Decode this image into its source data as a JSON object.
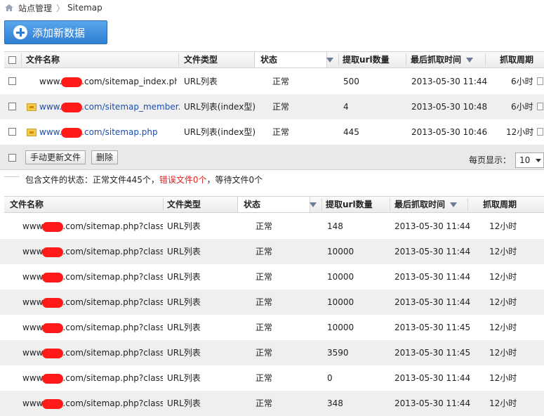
{
  "breadcrumb": {
    "home": "站点管理",
    "current": "Sitemap"
  },
  "add_button": {
    "label": "添加新数据"
  },
  "top_table": {
    "headers": {
      "name": "文件名称",
      "type": "文件类型",
      "status": "状态",
      "url_count": "提取url数量",
      "last_fetch": "最后抓取时间",
      "period": "抓取周期"
    },
    "rows": [
      {
        "prefix": "www.",
        "suffix": ".com/sitemap_index.php",
        "type": "URL列表",
        "status": "正常",
        "url_count": "500",
        "last_fetch": "2013-05-30 11:44",
        "period": "6小时",
        "folder": false,
        "link": false
      },
      {
        "prefix": "www.",
        "suffix": ".com/sitemap_member.ph",
        "type": "URL列表(index型)",
        "status": "正常",
        "url_count": "4",
        "last_fetch": "2013-05-30 10:48",
        "period": "6小时",
        "folder": true,
        "link": true
      },
      {
        "prefix": "www.",
        "suffix": ".com/sitemap.php",
        "type": "URL列表(index型)",
        "status": "正常",
        "url_count": "445",
        "last_fetch": "2013-05-30 10:46",
        "period": "12小时",
        "folder": true,
        "link": true
      }
    ]
  },
  "toolbar": {
    "refresh_label": "手动更新文件",
    "delete_label": "删除",
    "per_page_label": "每页显示：",
    "per_page_value": "10"
  },
  "status_line": {
    "prefix": "包含文件的状态：正常文件445个，",
    "error": "错误文件0个",
    "suffix": "，等待文件0个"
  },
  "sub_table": {
    "headers": {
      "name": "文件名称",
      "type": "文件类型",
      "status": "状态",
      "url_count": "提取url数量",
      "last_fetch": "最后抓取时间",
      "period": "抓取周期"
    },
    "rows": [
      {
        "prefix": "www",
        "suffix": ".com/sitemap.php?classi",
        "type": "URL列表",
        "status": "正常",
        "url_count": "148",
        "last_fetch": "2013-05-30 11:44",
        "period": "12小时"
      },
      {
        "prefix": "www",
        "suffix": ".com/sitemap.php?classi",
        "type": "URL列表",
        "status": "正常",
        "url_count": "10000",
        "last_fetch": "2013-05-30 11:44",
        "period": "12小时"
      },
      {
        "prefix": "www",
        "suffix": ".com/sitemap.php?classi",
        "type": "URL列表",
        "status": "正常",
        "url_count": "10000",
        "last_fetch": "2013-05-30 11:44",
        "period": "12小时"
      },
      {
        "prefix": "www",
        "suffix": ".com/sitemap.php?classi",
        "type": "URL列表",
        "status": "正常",
        "url_count": "10000",
        "last_fetch": "2013-05-30 11:44",
        "period": "12小时"
      },
      {
        "prefix": "www",
        "suffix": ".com/sitemap.php?classi",
        "type": "URL列表",
        "status": "正常",
        "url_count": "10000",
        "last_fetch": "2013-05-30 11:45",
        "period": "12小时"
      },
      {
        "prefix": "www",
        "suffix": ".com/sitemap.php?classi",
        "type": "URL列表",
        "status": "正常",
        "url_count": "3590",
        "last_fetch": "2013-05-30 11:45",
        "period": "12小时"
      },
      {
        "prefix": "www",
        "suffix": ".com/sitemap.php?classi",
        "type": "URL列表",
        "status": "正常",
        "url_count": "0",
        "last_fetch": "2013-05-30 11:44",
        "period": "12小时"
      },
      {
        "prefix": "www",
        "suffix": ".com/sitemap.php?classi",
        "type": "URL列表",
        "status": "正常",
        "url_count": "348",
        "last_fetch": "2013-05-30 11:44",
        "period": "12小时"
      }
    ]
  }
}
